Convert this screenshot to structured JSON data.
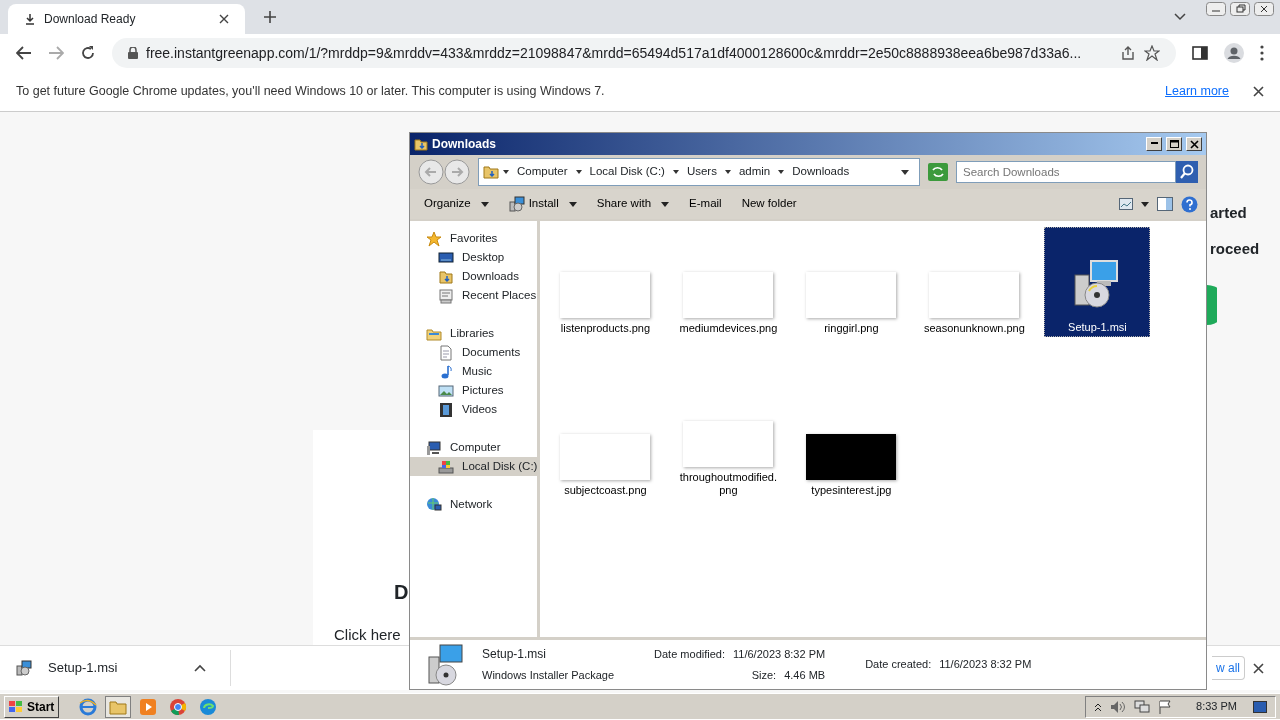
{
  "browser": {
    "tab": {
      "title": "Download Ready"
    },
    "url": "free.instantgreenapp.com/1/?mrddp=9&mrddv=433&mrddz=21098847&mrdd=65494d517a1df4000128600c&mrddr=2e50c8888938eea6be987d33a6...",
    "infobar": {
      "text": "To get future Google Chrome updates, you'll need Windows 10 or later. This computer is using Windows 7.",
      "link": "Learn more"
    }
  },
  "page": {
    "fragments": [
      "arted",
      "roceed"
    ],
    "card_heading": "D",
    "card_text": "Click here"
  },
  "explorer": {
    "title": "Downloads",
    "breadcrumb": [
      "Computer",
      "Local Disk (C:)",
      "Users",
      "admin",
      "Downloads"
    ],
    "search": {
      "placeholder": "Search Downloads"
    },
    "toolbar": [
      {
        "label": "Organize",
        "kind": "plain",
        "dropdown": true
      },
      {
        "label": "Install",
        "kind": "install",
        "dropdown": true
      },
      {
        "label": "Share with",
        "kind": "plain",
        "dropdown": true
      },
      {
        "label": "E-mail",
        "kind": "plain",
        "dropdown": false
      },
      {
        "label": "New folder",
        "kind": "plain",
        "dropdown": false
      }
    ],
    "nav": [
      {
        "label": "Favorites",
        "kind": "star",
        "selected": false,
        "children": [
          {
            "label": "Desktop",
            "kind": "desktop",
            "selected": false
          },
          {
            "label": "Downloads",
            "kind": "downloads",
            "selected": false
          },
          {
            "label": "Recent Places",
            "kind": "recent",
            "selected": false
          }
        ]
      },
      {
        "label": "Libraries",
        "kind": "library",
        "selected": false,
        "children": [
          {
            "label": "Documents",
            "kind": "document",
            "selected": false
          },
          {
            "label": "Music",
            "kind": "music",
            "selected": false
          },
          {
            "label": "Pictures",
            "kind": "pictures",
            "selected": false
          },
          {
            "label": "Videos",
            "kind": "videos",
            "selected": false
          }
        ]
      },
      {
        "label": "Computer",
        "kind": "computer",
        "selected": false,
        "children": [
          {
            "label": "Local Disk (C:)",
            "kind": "disk",
            "selected": true
          }
        ]
      },
      {
        "label": "Network",
        "kind": "network",
        "selected": false
      }
    ],
    "files": [
      {
        "name": "listenproducts.png",
        "kind": "thumbnail",
        "dark": false,
        "selected": false
      },
      {
        "name": "mediumdevices.png",
        "kind": "thumbnail",
        "dark": false,
        "selected": false
      },
      {
        "name": "ringgirl.png",
        "kind": "thumbnail",
        "dark": false,
        "selected": false
      },
      {
        "name": "seasonunknown.png",
        "kind": "thumbnail",
        "dark": false,
        "selected": false
      },
      {
        "name": "Setup-1.msi",
        "kind": "installer",
        "selected": true
      },
      {
        "name": "subjectcoast.png",
        "kind": "thumbnail",
        "dark": false,
        "selected": false
      },
      {
        "name": "throughoutmodified.png",
        "kind": "thumbnail",
        "dark": false,
        "selected": false
      },
      {
        "name": "typesinterest.jpg",
        "kind": "thumbnail",
        "dark": true,
        "selected": false
      }
    ],
    "details": {
      "name": "Setup-1.msi",
      "type": "Windows Installer Package",
      "fields": [
        {
          "label": "Date modified:",
          "value": "11/6/2023 8:32 PM"
        },
        {
          "label": "Size:",
          "value": "4.46 MB"
        },
        {
          "label": "Date created:",
          "value": "11/6/2023 8:32 PM"
        }
      ]
    }
  },
  "download_bar": {
    "file": "Setup-1.msi",
    "show_all": "w all"
  },
  "taskbar": {
    "start": "Start",
    "time": "8:33 PM"
  }
}
